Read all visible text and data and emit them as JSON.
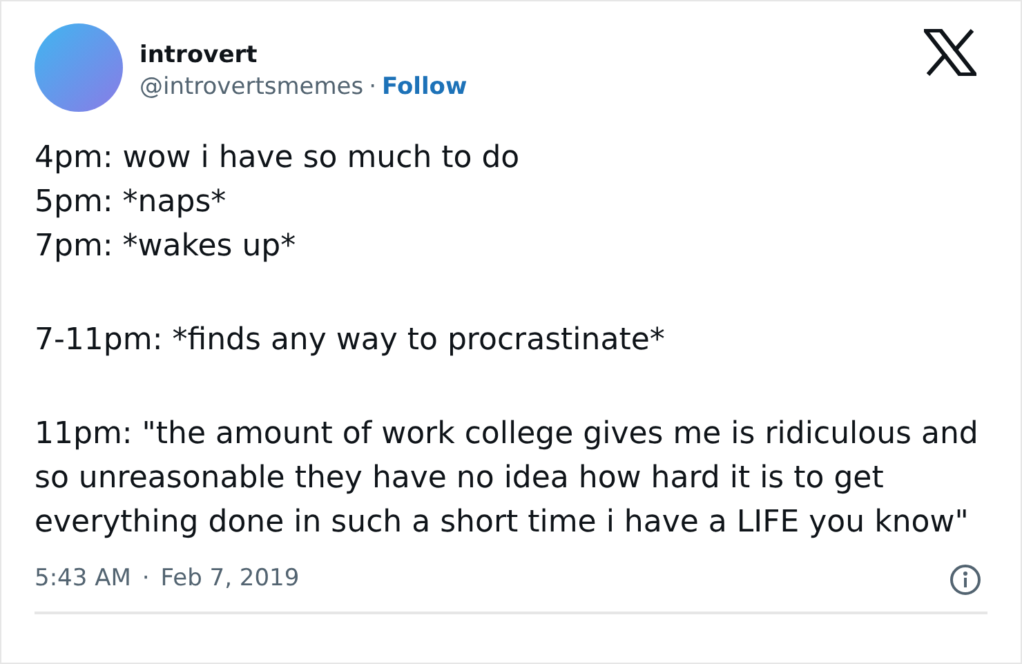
{
  "author": {
    "name": "introvert",
    "handle": "@introvertsmemes",
    "separator": "·",
    "follow": "Follow"
  },
  "body": [
    [
      "4pm: wow i have so much to do",
      "5pm: *naps*",
      "7pm: *wakes up*"
    ],
    [
      "7-11pm: *finds any way to procrastinate*"
    ],
    [
      "11pm: \"the amount of work college gives me is ridiculous and so unreasonable they have no idea how hard it is to get everything done in such a short time i have a LIFE you know\""
    ]
  ],
  "footer": {
    "time": "5:43 AM",
    "separator": "·",
    "date": "Feb 7, 2019"
  }
}
